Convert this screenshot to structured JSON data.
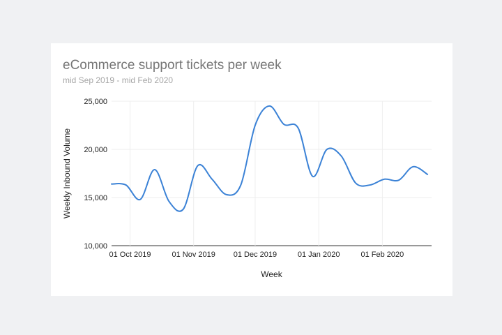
{
  "chart_data": {
    "type": "line",
    "title": "eCommerce support tickets per week",
    "subtitle": "mid Sep 2019 - mid Feb 2020",
    "xlabel": "Week",
    "ylabel": "Weekly Inbound Volume",
    "ylim": [
      10000,
      25000
    ],
    "yticks": [
      10000,
      15000,
      20000,
      25000
    ],
    "ytick_labels": [
      "10,000",
      "15,000",
      "20,000",
      "25,000"
    ],
    "xticks": [
      "2019-10-01",
      "2019-11-01",
      "2019-12-01",
      "2020-01-01",
      "2020-02-01"
    ],
    "xtick_labels": [
      "01 Oct 2019",
      "01 Nov 2019",
      "01 Dec 2019",
      "01 Jan 2020",
      "01 Feb 2020"
    ],
    "xlim": [
      "2019-09-22",
      "2020-02-25"
    ],
    "grid": true,
    "line_color": "#3b82d6",
    "series": [
      {
        "x": [
          "2019-09-22",
          "2019-09-29",
          "2019-10-06",
          "2019-10-13",
          "2019-10-20",
          "2019-10-27",
          "2019-11-03",
          "2019-11-10",
          "2019-11-17",
          "2019-11-24",
          "2019-12-01",
          "2019-12-08",
          "2019-12-15",
          "2019-12-22",
          "2019-12-29",
          "2020-01-05",
          "2020-01-12",
          "2020-01-19",
          "2020-01-26",
          "2020-02-02",
          "2020-02-09",
          "2020-02-16",
          "2020-02-23"
        ],
        "values": [
          16400,
          16300,
          14800,
          17900,
          14600,
          13800,
          18300,
          16900,
          15300,
          16300,
          22500,
          24500,
          22600,
          22200,
          17200,
          20000,
          19300,
          16500,
          16300,
          16900,
          16800,
          18200,
          17400
        ]
      }
    ]
  }
}
